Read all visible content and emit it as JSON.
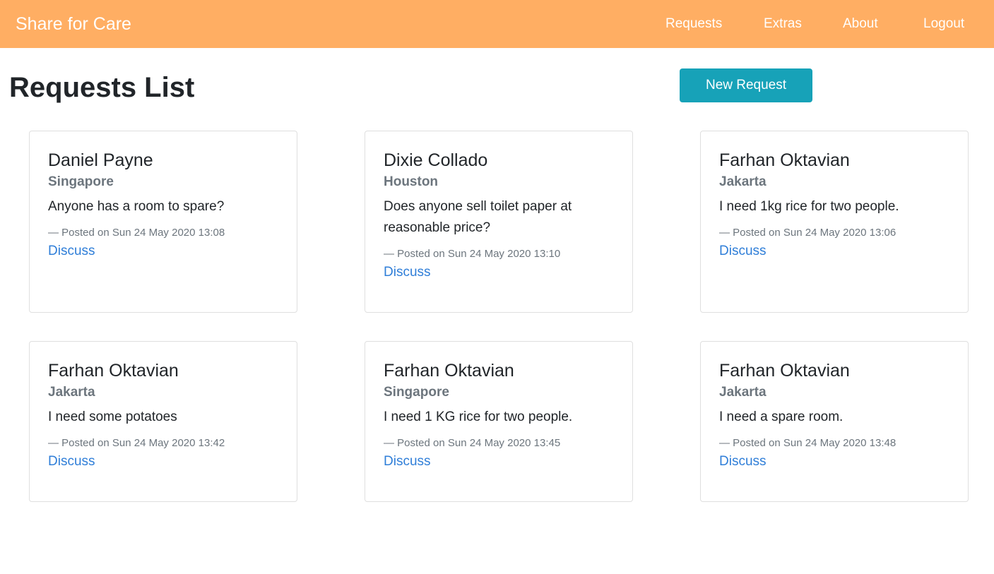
{
  "navbar": {
    "brand": "Share for Care",
    "links": [
      "Requests",
      "Extras",
      "About",
      "Logout"
    ]
  },
  "page": {
    "title": "Requests List",
    "new_request_label": "New Request"
  },
  "requests": [
    {
      "name": "Daniel Payne",
      "city": "Singapore",
      "text": "Anyone has a room to spare?",
      "posted": "— Posted on Sun 24 May 2020 13:08",
      "link": "Discuss"
    },
    {
      "name": "Dixie Collado",
      "city": "Houston",
      "text": "Does anyone sell toilet paper at reasonable price?",
      "posted": "— Posted on Sun 24 May 2020 13:10",
      "link": "Discuss"
    },
    {
      "name": "Farhan Oktavian",
      "city": "Jakarta",
      "text": "I need 1kg rice for two people.",
      "posted": "— Posted on Sun 24 May 2020 13:06",
      "link": "Discuss"
    },
    {
      "name": "Farhan Oktavian",
      "city": "Jakarta",
      "text": "I need some potatoes",
      "posted": "— Posted on Sun 24 May 2020 13:42",
      "link": "Discuss"
    },
    {
      "name": "Farhan Oktavian",
      "city": "Singapore",
      "text": "I need 1 KG rice for two people.",
      "posted": "— Posted on Sun 24 May 2020 13:45",
      "link": "Discuss"
    },
    {
      "name": "Farhan Oktavian",
      "city": "Jakarta",
      "text": "I need a spare room.",
      "posted": "— Posted on Sun 24 May 2020 13:48",
      "link": "Discuss"
    }
  ]
}
